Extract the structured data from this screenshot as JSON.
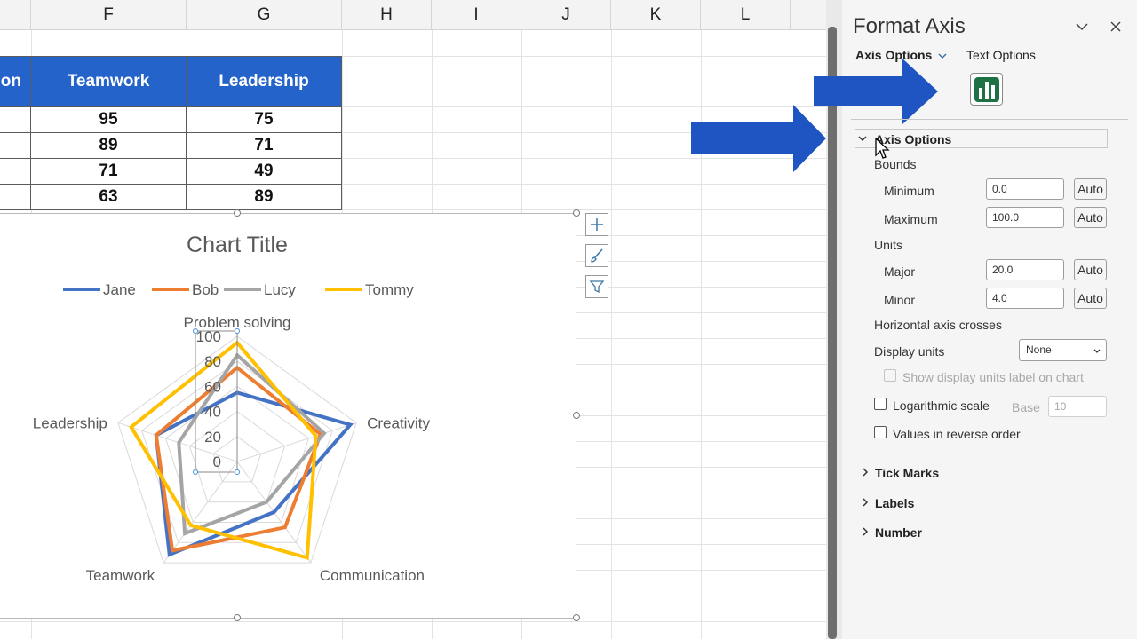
{
  "sheet": {
    "columns": [
      "F",
      "G",
      "H",
      "I",
      "J",
      "K",
      "L"
    ],
    "table_headers": [
      "on",
      "Teamwork",
      "Leadership"
    ],
    "table_rows": [
      [
        "95",
        "75"
      ],
      [
        "89",
        "71"
      ],
      [
        "71",
        "49"
      ],
      [
        "63",
        "89"
      ]
    ]
  },
  "chart": {
    "title": "Chart Title",
    "legend": [
      "Jane",
      "Bob",
      "Lucy",
      "Tommy"
    ],
    "series_colors": [
      "#4472c4",
      "#ed7d31",
      "#a5a5a5",
      "#ffc000"
    ],
    "axis_labels": [
      "Problem solving",
      "Creativity",
      "Communication",
      "Teamwork",
      "Leadership"
    ],
    "tick_labels": [
      "100",
      "80",
      "60",
      "40",
      "20",
      "0"
    ]
  },
  "chart_data": {
    "type": "radar",
    "title": "Chart Title",
    "categories": [
      "Problem solving",
      "Creativity",
      "Communication",
      "Teamwork",
      "Leadership"
    ],
    "series": [
      {
        "name": "Jane",
        "values": [
          55,
          95,
          50,
          92,
          68
        ]
      },
      {
        "name": "Bob",
        "values": [
          75,
          70,
          65,
          88,
          68
        ]
      },
      {
        "name": "Lucy",
        "values": [
          85,
          73,
          40,
          71,
          49
        ]
      },
      {
        "name": "Tommy",
        "values": [
          95,
          66,
          95,
          63,
          89
        ]
      }
    ],
    "ylim": [
      0,
      100
    ],
    "major_unit": 20,
    "grid": true,
    "legend_position": "top"
  },
  "panel": {
    "title": "Format Axis",
    "tab_axis_options": "Axis Options",
    "tab_text_options": "Text Options",
    "section_axis_options": "Axis Options",
    "bounds_label": "Bounds",
    "minimum_label": "Minimum",
    "minimum_value": "0.0",
    "maximum_label": "Maximum",
    "maximum_value": "100.0",
    "units_label": "Units",
    "major_label": "Major",
    "major_value": "20.0",
    "minor_label": "Minor",
    "minor_value": "4.0",
    "auto_label": "Auto",
    "horizontal_axis_crosses": "Horizontal axis crosses",
    "display_units_label": "Display units",
    "display_units_value": "None",
    "show_units_label": "Show display units label on chart",
    "log_scale_label": "Logarithmic scale",
    "base_label": "Base",
    "base_value": "10",
    "reverse_label": "Values in reverse order",
    "tick_marks": "Tick Marks",
    "labels": "Labels",
    "number": "Number"
  },
  "colors": {
    "header_blue": "#2463c9",
    "arrow_blue": "#1f55c2",
    "icon_green": "#1e7145"
  },
  "icons": [
    "chevron-down-icon",
    "close-icon",
    "bar-chart-icon",
    "plus-icon",
    "brush-icon",
    "filter-icon",
    "arrow-pointer-icon",
    "cursor-icon"
  ]
}
